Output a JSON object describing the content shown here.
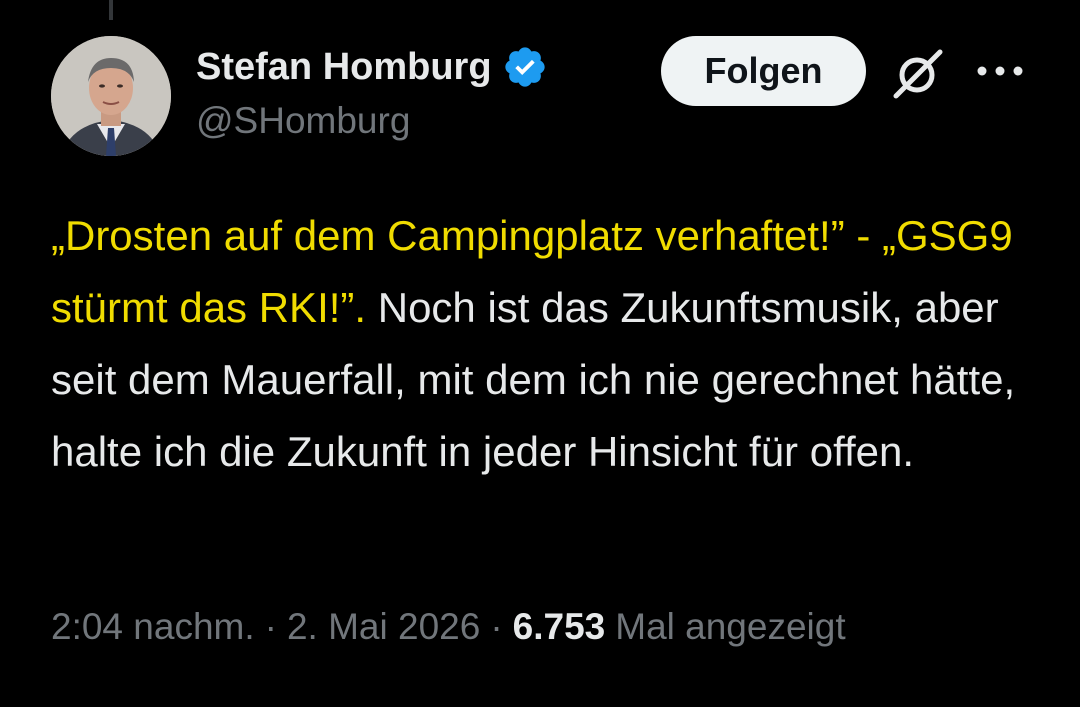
{
  "author": {
    "display_name": "Stefan Homburg",
    "handle": "@SHomburg",
    "verified": true,
    "avatar_icon": "profile-photo"
  },
  "actions": {
    "follow_label": "Folgen",
    "grok_icon": "grok-icon",
    "more_icon": "more-icon"
  },
  "tweet": {
    "quote_text": "„Drosten auf dem Campingplatz verhaftet!” - „GSG9 stürmt das RKI!”.",
    "body_text": " Noch ist das Zukunftsmusik, aber seit dem Mauerfall, mit dem ich nie gerechnet hätte, halte ich die Zukunft in jeder Hinsicht für offen."
  },
  "meta": {
    "time": "2:04 nachm.",
    "separator": "·",
    "date": "2. Mai 2026",
    "views_count": "6.753",
    "views_label": "Mal angezeigt"
  },
  "colors": {
    "background": "#000000",
    "primary_text": "#e7e9ea",
    "secondary_text": "#71767b",
    "quote_highlight": "#f0dc00",
    "verified_badge": "#1d9bf0",
    "follow_button_bg": "#eff3f4"
  }
}
